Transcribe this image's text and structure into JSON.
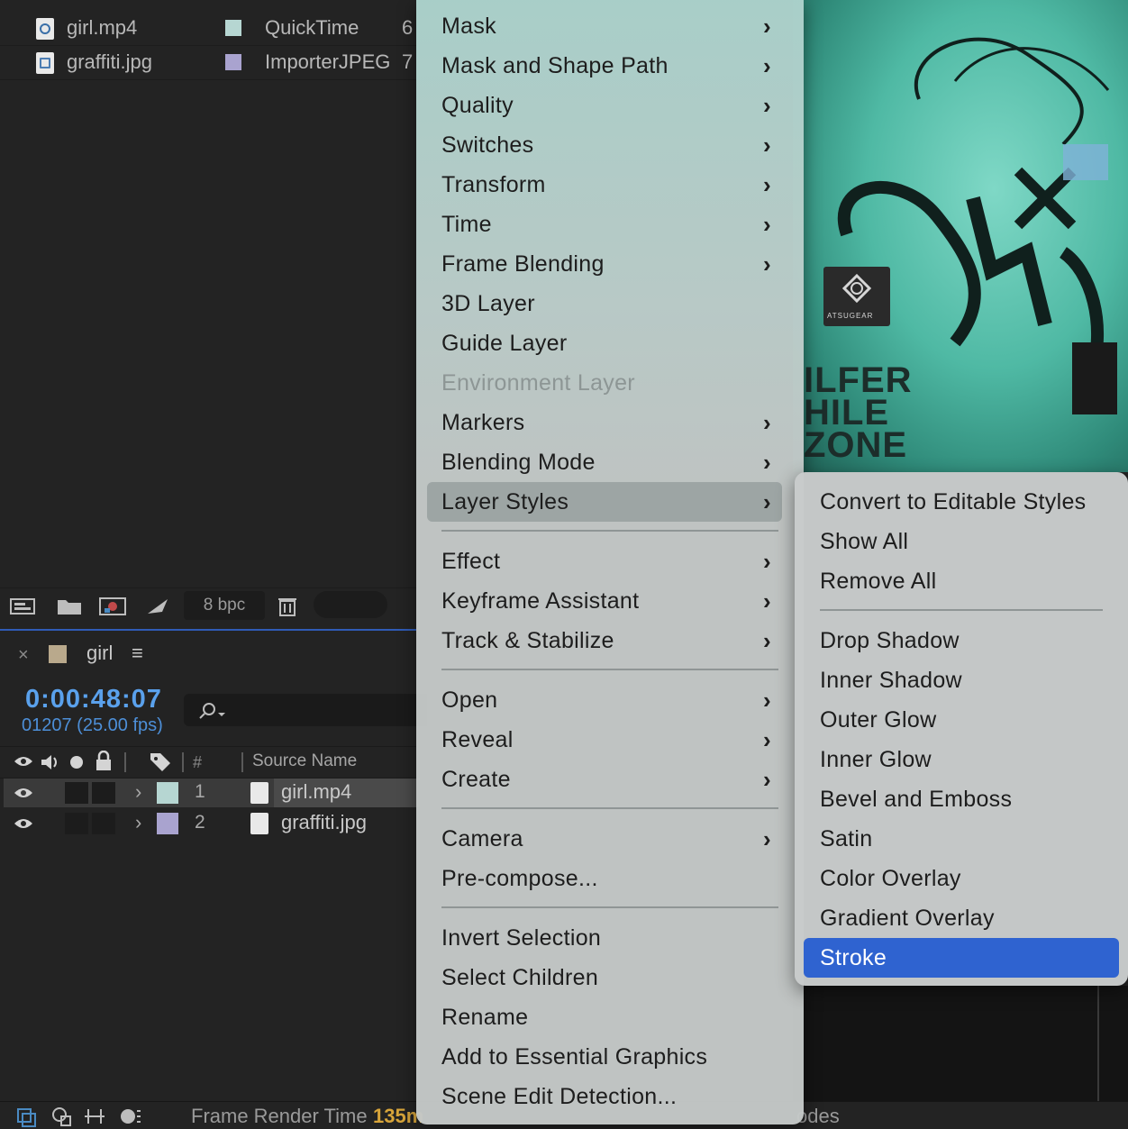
{
  "project": {
    "items": [
      {
        "name": "girl.mp4",
        "type": "QuickTime",
        "size": "6",
        "color": "#b6d6d2"
      },
      {
        "name": "graffiti.jpg",
        "type": "ImporterJPEG",
        "size": "7",
        "color": "#a9a3cf"
      }
    ],
    "bit_depth": "8 bpc"
  },
  "timeline": {
    "comp_name": "girl",
    "comp_color": "#b9a98c",
    "timecode": "0:00:48:07",
    "frames": "01207 (25.00 fps)",
    "columns": {
      "number": "#",
      "source_name": "Source Name"
    },
    "layers": [
      {
        "number": "1",
        "name": "girl.mp4",
        "color": "#b6d6d2",
        "selected": true
      },
      {
        "number": "2",
        "name": "graffiti.jpg",
        "color": "#a9a3cf",
        "selected": false
      }
    ]
  },
  "status_bar": {
    "render_label": "Frame Render Time",
    "render_value": "135m",
    "modes_label": "odes"
  },
  "viewer": {
    "sticker_text": "ATSUGEAR",
    "graffiti_text": [
      "ILFER",
      "HILE",
      "ZONE"
    ]
  },
  "context_menu": {
    "items": [
      {
        "label": "Mask",
        "submenu": true
      },
      {
        "label": "Mask and Shape Path",
        "submenu": true
      },
      {
        "label": "Quality",
        "submenu": true
      },
      {
        "label": "Switches",
        "submenu": true
      },
      {
        "label": "Transform",
        "submenu": true
      },
      {
        "label": "Time",
        "submenu": true
      },
      {
        "label": "Frame Blending",
        "submenu": true
      },
      {
        "label": "3D Layer",
        "submenu": false
      },
      {
        "label": "Guide Layer",
        "submenu": false
      },
      {
        "label": "Environment Layer",
        "submenu": false,
        "disabled": true
      },
      {
        "label": "Markers",
        "submenu": true
      },
      {
        "label": "Blending Mode",
        "submenu": true
      },
      {
        "label": "Layer Styles",
        "submenu": true,
        "highlighted": true
      },
      {
        "label": "Effect",
        "submenu": true
      },
      {
        "label": "Keyframe Assistant",
        "submenu": true
      },
      {
        "label": "Track & Stabilize",
        "submenu": true
      },
      {
        "label": "Open",
        "submenu": true
      },
      {
        "label": "Reveal",
        "submenu": true
      },
      {
        "label": "Create",
        "submenu": true
      },
      {
        "label": "Camera",
        "submenu": true
      },
      {
        "label": "Pre-compose...",
        "submenu": false
      },
      {
        "label": "Invert Selection",
        "submenu": false
      },
      {
        "label": "Select Children",
        "submenu": false
      },
      {
        "label": "Rename",
        "submenu": false
      },
      {
        "label": "Add to Essential Graphics",
        "submenu": false
      },
      {
        "label": "Scene Edit Detection...",
        "submenu": false
      }
    ]
  },
  "layer_styles_submenu": {
    "items": [
      {
        "label": "Convert to Editable Styles"
      },
      {
        "label": "Show All"
      },
      {
        "label": "Remove All"
      },
      {
        "label": "Drop Shadow"
      },
      {
        "label": "Inner Shadow"
      },
      {
        "label": "Outer Glow"
      },
      {
        "label": "Inner Glow"
      },
      {
        "label": "Bevel and Emboss"
      },
      {
        "label": "Satin"
      },
      {
        "label": "Color Overlay"
      },
      {
        "label": "Gradient Overlay"
      },
      {
        "label": "Stroke",
        "active": true
      }
    ]
  },
  "icons": {
    "arrow": "›",
    "close": "×",
    "menu": "≡"
  },
  "colors": {
    "accent": "#2f63d0",
    "timecode": "#5aa1ec",
    "render_value": "#d8a53a"
  }
}
